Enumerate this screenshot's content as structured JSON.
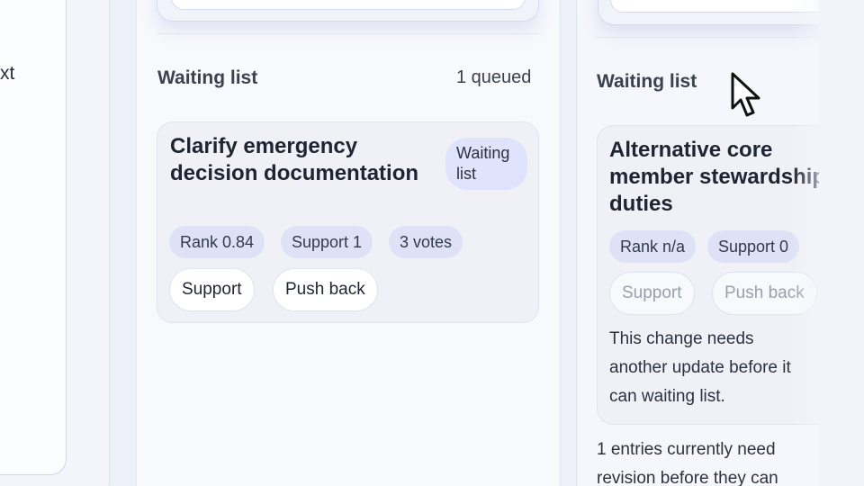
{
  "left_panel": {
    "partial_text": "xt"
  },
  "middle": {
    "section_title": "Waiting list",
    "queue_count": "1 queued",
    "card": {
      "title": "Clarify emergency decision documentation",
      "status": "Waiting list",
      "chips": [
        "Rank 0.84",
        "Support 1",
        "3 votes"
      ],
      "actions": [
        "Support",
        "Push back"
      ]
    }
  },
  "right": {
    "section_title": "Waiting list",
    "card": {
      "title": "Alternative core member stewardship duties",
      "chips": [
        "Rank n/a",
        "Support 0"
      ],
      "actions": [
        "Support",
        "Push back"
      ],
      "note": "This change needs another update before it can waiting list."
    },
    "footer_note": "1 entries currently need revision before they can"
  },
  "icons": {
    "cursor": "mouse-pointer-icon"
  }
}
